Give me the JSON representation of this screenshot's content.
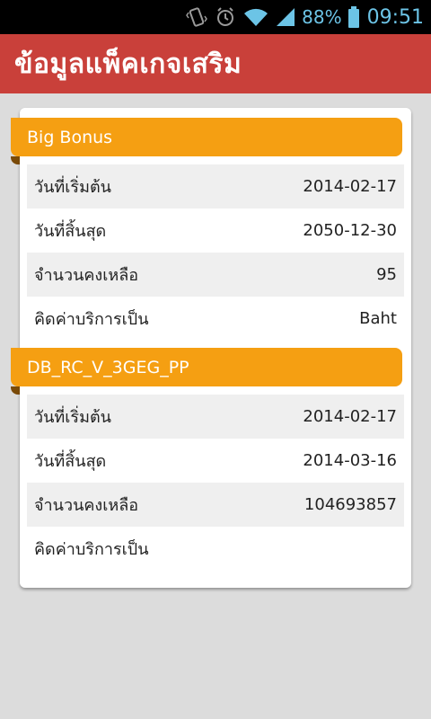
{
  "status_bar": {
    "icons": [
      "vibrate-icon",
      "alarm-icon",
      "wifi-icon",
      "signal-icon",
      "battery-icon"
    ],
    "battery": "88%",
    "time": "09:51",
    "accent_color": "#6cc4e6"
  },
  "header": {
    "title": "ข้อมูลแพ็คเกจเสริม",
    "color": "#c9403a"
  },
  "packages": [
    {
      "name": "Big Bonus",
      "rows": [
        {
          "label": "วันที่เริ่มต้น",
          "value": "2014-02-17"
        },
        {
          "label": "วันที่สิ้นสุด",
          "value": "2050-12-30"
        },
        {
          "label": "จำนวนคงเหลือ",
          "value": "95"
        },
        {
          "label": "คิดค่าบริการเป็น",
          "value": "Baht"
        }
      ]
    },
    {
      "name": "DB_RC_V_3GEG_PP",
      "rows": [
        {
          "label": "วันที่เริ่มต้น",
          "value": "2014-02-17"
        },
        {
          "label": "วันที่สิ้นสุด",
          "value": "2014-03-16"
        },
        {
          "label": "จำนวนคงเหลือ",
          "value": "104693857"
        },
        {
          "label": "คิดค่าบริการเป็น",
          "value": ""
        }
      ]
    }
  ],
  "section_color": "#f59f12"
}
